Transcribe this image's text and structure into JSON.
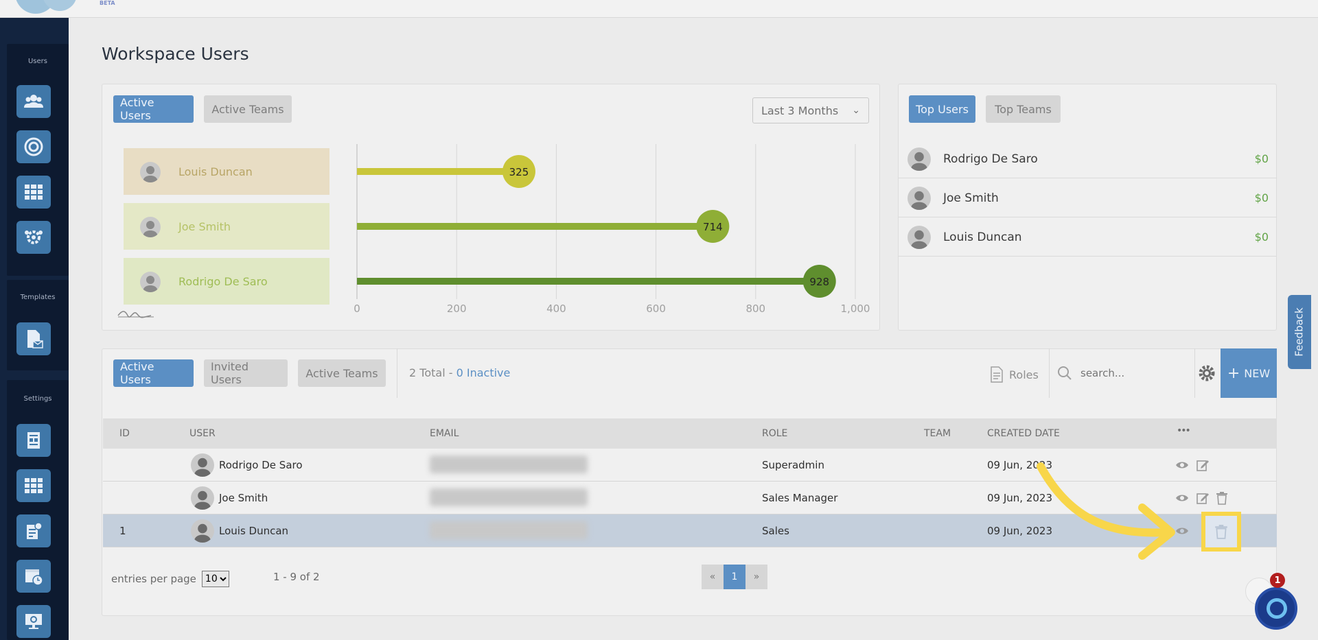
{
  "app": {
    "beta_label": "BETA"
  },
  "sidebar": {
    "sections": [
      {
        "label": "Users",
        "items": [
          "users-group-icon",
          "target-icon",
          "grid-icon",
          "team-settings-icon"
        ]
      },
      {
        "label": "Templates",
        "items": [
          "document-mail-icon"
        ]
      },
      {
        "label": "Settings",
        "items": [
          "report-icon",
          "grid-icon",
          "invoice-icon",
          "calendar-clock-icon",
          "monitor-settings-icon"
        ]
      }
    ]
  },
  "page": {
    "title": "Workspace Users"
  },
  "chart_card": {
    "tabs": [
      {
        "label": "Active Users",
        "active": true
      },
      {
        "label": "Active Teams",
        "active": false
      }
    ],
    "period": {
      "selected": "Last 3 Months"
    }
  },
  "chart_data": {
    "type": "bar",
    "orientation": "horizontal",
    "categories": [
      "Louis Duncan",
      "Joe Smith",
      "Rodrigo De Saro"
    ],
    "values": [
      325,
      714,
      928
    ],
    "colors": [
      "#c9c63a",
      "#8fae36",
      "#5f8e2e"
    ],
    "xticks": [
      "0",
      "200",
      "400",
      "600",
      "800",
      "1,000"
    ],
    "xlim": [
      0,
      1000
    ],
    "grid": true
  },
  "top_users_card": {
    "tabs": [
      {
        "label": "Top Users",
        "active": true
      },
      {
        "label": "Top Teams",
        "active": false
      }
    ],
    "rows": [
      {
        "name": "Rodrigo De Saro",
        "amount": "$0"
      },
      {
        "name": "Joe Smith",
        "amount": "$0"
      },
      {
        "name": "Louis Duncan",
        "amount": "$0"
      }
    ]
  },
  "users_card": {
    "tabs": [
      {
        "label": "Active Users",
        "active": true
      },
      {
        "label": "Invited Users",
        "active": false
      },
      {
        "label": "Active Teams",
        "active": false
      }
    ],
    "summary": {
      "total": "2 Total",
      "sep": " - ",
      "inactive": "0 Inactive"
    },
    "roles_label": "Roles",
    "search_placeholder": "search...",
    "new_label": "NEW",
    "columns": [
      "ID",
      "USER",
      "EMAIL",
      "ROLE",
      "TEAM",
      "CREATED DATE",
      "•••"
    ],
    "rows": [
      {
        "id": "",
        "user": "Rodrigo De Saro",
        "role": "Superadmin",
        "team": "",
        "created": "09 Jun, 2023"
      },
      {
        "id": "",
        "user": "Joe Smith",
        "role": "Sales Manager",
        "team": "",
        "created": "09 Jun, 2023"
      },
      {
        "id": "1",
        "user": "Louis Duncan",
        "role": "Sales",
        "team": "",
        "created": "09 Jun, 2023"
      }
    ],
    "entries_label": "entries per page",
    "entries_value": "10",
    "range": "1 - 9 of 2",
    "pager": {
      "prev": "«",
      "current": "1",
      "next": "»"
    }
  },
  "feedback_label": "Feedback",
  "chat": {
    "badge": "1"
  },
  "colors": {
    "accent": "#5b8fc4",
    "sidebar": "#13243f",
    "highlight": "#f8d64a",
    "money": "#62a447"
  }
}
